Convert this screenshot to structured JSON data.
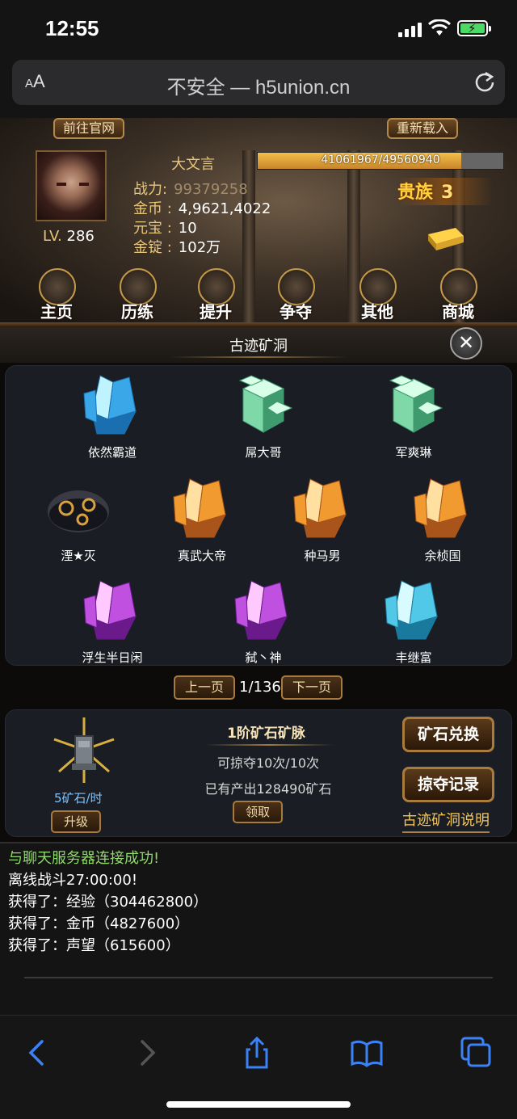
{
  "status": {
    "time": "12:55"
  },
  "browser": {
    "aa_small": "A",
    "aa_large": "A",
    "url_text": "不安全 — h5union.cn"
  },
  "game": {
    "top_buttons": {
      "official": "前往官网",
      "reload": "重新载入"
    },
    "player": {
      "name": "大文言",
      "level_label": "LV.",
      "level": "286",
      "exp_text": "41061967/49560940",
      "exp_fraction": 0.8285,
      "power_label": "战力:",
      "power": "99379258",
      "gold_label": "金币 :",
      "gold": "4,9621,4022",
      "yuanbao_label": "元宝 :",
      "yuanbao": "10",
      "ingot_label": "金锭 :",
      "ingot": "102万",
      "noble_label": "贵族",
      "noble_level": "3"
    },
    "nav": [
      "主页",
      "历练",
      "提升",
      "争夺",
      "其他",
      "商城"
    ],
    "panel_title": "古迹矿洞",
    "mines": [
      {
        "name": "依然霸道",
        "type": "blue-crystal"
      },
      {
        "name": "屌大哥",
        "type": "jade-cube"
      },
      {
        "name": "军爽琳",
        "type": "jade-cube"
      },
      {
        "name": "湮★灭",
        "type": "dark-ore"
      },
      {
        "name": "真武大帝",
        "type": "amber"
      },
      {
        "name": "种马男",
        "type": "amber"
      },
      {
        "name": "余桢国",
        "type": "amber"
      },
      {
        "name": "浮生半日闲",
        "type": "purple"
      },
      {
        "name": "弑丶神",
        "type": "purple"
      },
      {
        "name": "丰继富",
        "type": "cyan"
      }
    ],
    "pager": {
      "prev": "上一页",
      "page": "1/136",
      "next": "下一页"
    },
    "my_mine": {
      "rate": "5矿石/时",
      "upgrade": "升级",
      "vein_name": "1阶矿石矿脉",
      "plunder": "可掠夺10次/10次",
      "produced": "已有产出128490矿石",
      "claim": "领取",
      "exchange": "矿石兑换",
      "records": "掠夺记录",
      "explain": "古迹矿洞说明"
    },
    "chat": [
      "与聊天服务器连接成功!",
      "离线战斗27:00:00!",
      "获得了：经验（304462800）",
      "获得了：金币（4827600）",
      "获得了：声望（615600）"
    ]
  },
  "colors": {
    "gold_text": "#e8c67a",
    "chat_green": "#8fd86a",
    "ios_blue": "#3b82f6"
  }
}
